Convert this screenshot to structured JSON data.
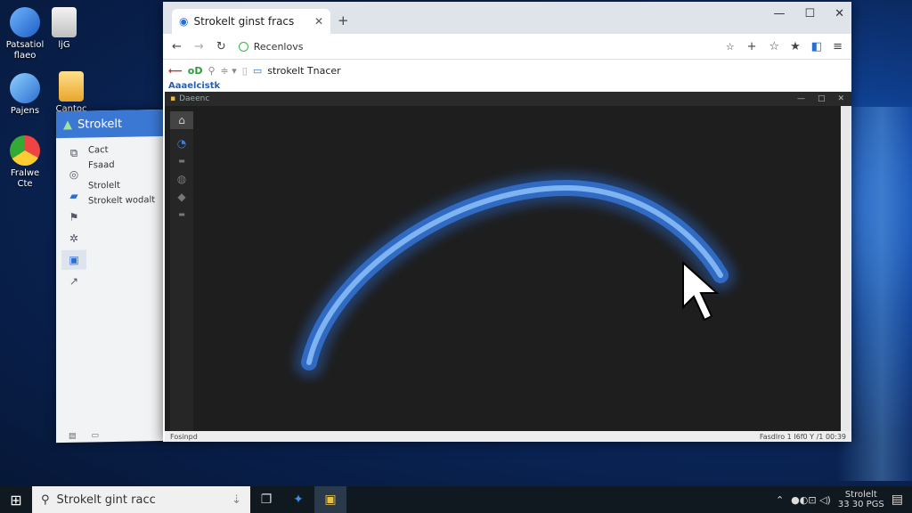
{
  "desktop": {
    "icons": [
      {
        "label": "Patsatiol\nflaeo",
        "color": "#3a7bd5"
      },
      {
        "label": "ljG",
        "color": "#d9d9d9"
      },
      {
        "label": "Pajens",
        "color": "#2f8fe0"
      },
      {
        "label": "Cantoc",
        "color": "#f1c04a"
      },
      {
        "label": "Fralwe\nCte",
        "color": "#e8a030"
      }
    ]
  },
  "explorer": {
    "title": "Strokelt",
    "items": [
      "Cact",
      "Fsaad",
      "Strolelt",
      "Strokelt wodalt"
    ]
  },
  "browser": {
    "tab_title": "Strokelt ginst fracs",
    "address": "Recenlovs",
    "bookmark_path": "strokelt Tnacer",
    "sublabel": "Aaaelcistk",
    "inner_title": "Daeenc",
    "status_left": "Fosinpd",
    "status_right": "Fasdlro 1 I6f0 Y /1 00:39"
  },
  "taskbar": {
    "search_text": "Strokelt gint racc",
    "clock_line1": "Strolelt",
    "clock_line2": "33 30 PGS"
  }
}
